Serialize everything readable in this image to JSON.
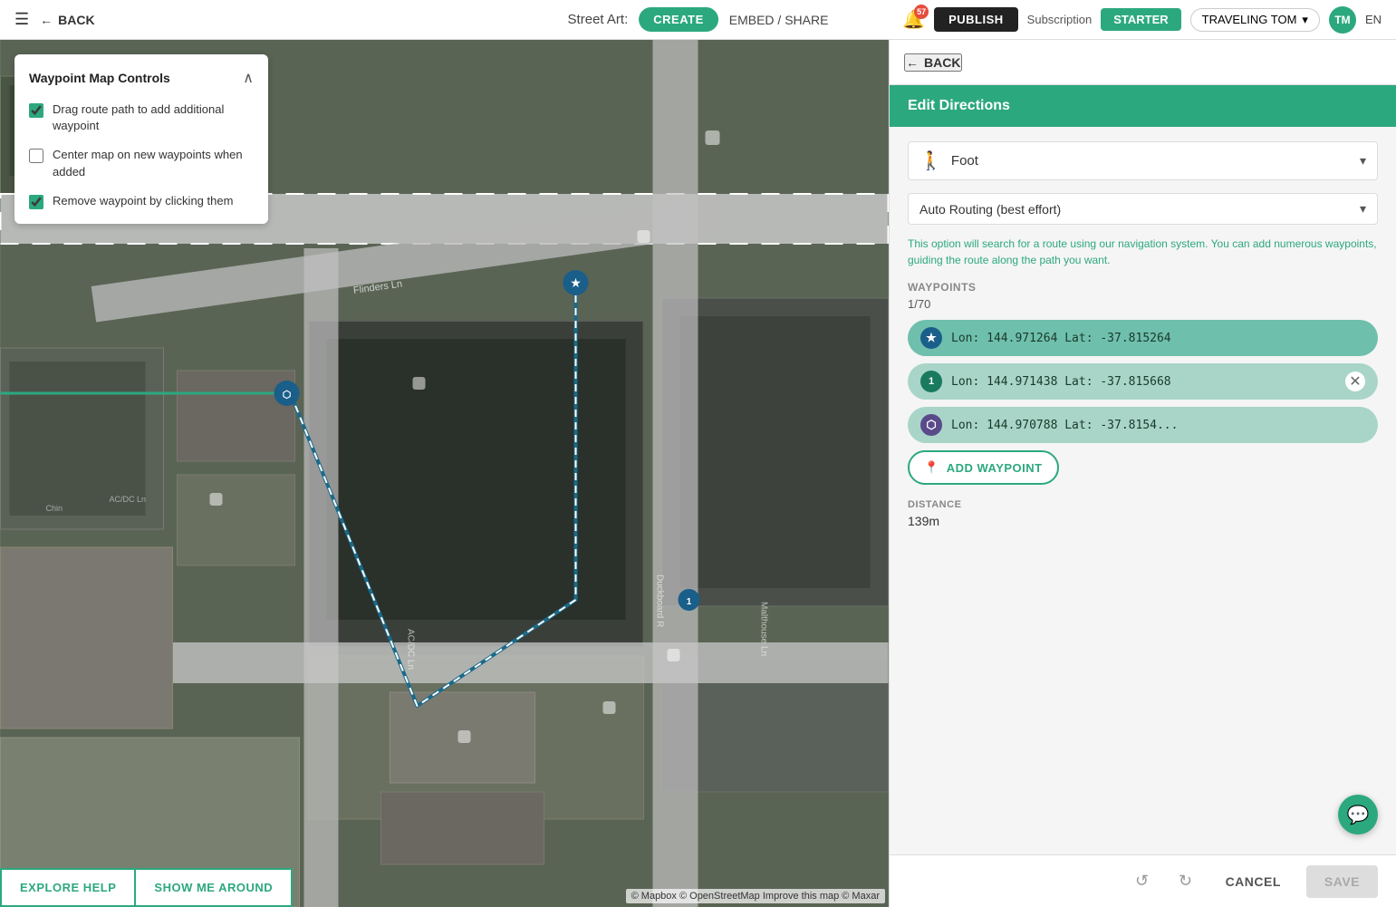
{
  "nav": {
    "menu_label": "☰",
    "back_label": "BACK",
    "street_art_label": "Street Art:",
    "create_label": "CREATE",
    "embed_share_label": "EMBED / SHARE",
    "bell_count": "57",
    "publish_label": "PUBLISH",
    "subscription_label": "Subscription",
    "starter_label": "STARTER",
    "user_label": "TRAVELING TOM",
    "user_initials": "TM",
    "lang_label": "EN"
  },
  "waypoint_panel": {
    "title": "Waypoint Map Controls",
    "collapse_icon": "∧",
    "controls": [
      {
        "id": "drag-route",
        "label": "Drag route path to add additional waypoint",
        "checked": true
      },
      {
        "id": "center-map",
        "label": "Center map on new waypoints when added",
        "checked": false
      },
      {
        "id": "remove-waypoint",
        "label": "Remove waypoint by clicking them",
        "checked": true
      }
    ]
  },
  "bottom_buttons": {
    "explore_help": "EXPLORE HELP",
    "show_me_around": "SHOW ME AROUND"
  },
  "map_attribution": "© Mapbox © OpenStreetMap Improve this map © Maxar",
  "right_panel": {
    "back_label": "BACK",
    "header_title": "Edit Directions",
    "transport": {
      "icon": "🚶",
      "label": "Foot"
    },
    "routing": {
      "label": "Auto Routing (best effort)",
      "description": "This option will search for a route using our navigation system. You can add numerous waypoints, guiding the route along the path you want."
    },
    "waypoints": {
      "label": "Waypoints",
      "count": "1/70",
      "items": [
        {
          "type": "star",
          "badge": "★",
          "coords": "Lon: 144.971264  Lat: -37.815264",
          "has_close": false
        },
        {
          "type": "number",
          "badge": "1",
          "coords": "Lon: 144.971438  Lat: -37.815668",
          "has_close": true
        },
        {
          "type": "route",
          "badge": "⬡",
          "coords": "Lon: 144.970788  Lat: -37.8154...",
          "has_close": false
        }
      ],
      "add_waypoint_label": "ADD WAYPOINT"
    },
    "distance": {
      "label": "DISTANCE",
      "value": "139m"
    }
  },
  "footer": {
    "undo_icon": "↺",
    "redo_icon": "↻",
    "cancel_label": "CANCEL",
    "save_label": "SAVE"
  }
}
